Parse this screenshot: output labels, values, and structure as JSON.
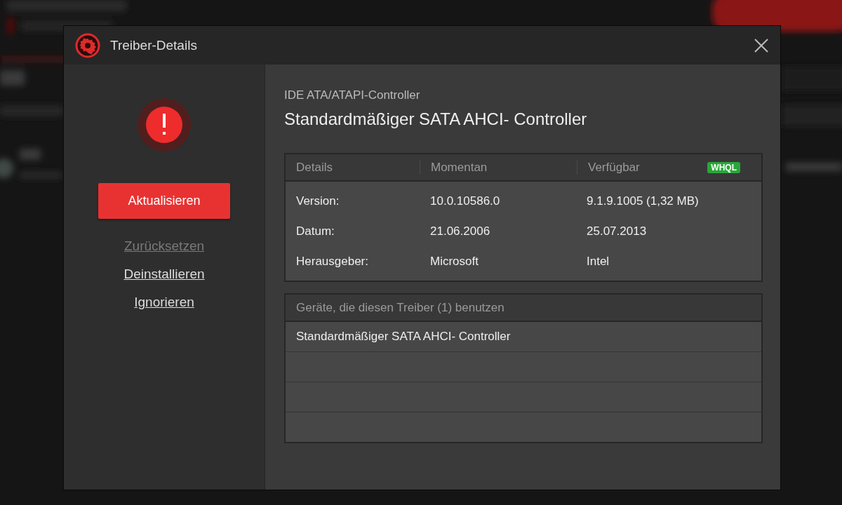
{
  "window": {
    "title": "Treiber-Details"
  },
  "actions": {
    "primary": "Aktualisieren",
    "links": [
      {
        "label": "Zurücksetzen",
        "disabled": true
      },
      {
        "label": "Deinstallieren",
        "disabled": false
      },
      {
        "label": "Ignorieren",
        "disabled": false
      }
    ]
  },
  "driver": {
    "category": "IDE ATA/ATAPI-Controller",
    "name": "Standardmäßiger SATA AHCI- Controller"
  },
  "details_table": {
    "columns": [
      "Details",
      "Momentan",
      "Verfügbar"
    ],
    "badge": "WHQL",
    "rows": [
      [
        "Version:",
        "10.0.10586.0",
        "9.1.9.1005 (1,32 MB)"
      ],
      [
        "Datum:",
        "21.06.2006",
        "25.07.2013"
      ],
      [
        "Herausgeber:",
        "Microsoft",
        "Intel"
      ]
    ]
  },
  "devices": {
    "header": "Geräte, die diesen Treiber (1) benutzen",
    "rows": [
      "Standardmäßiger SATA AHCI- Controller"
    ]
  }
}
